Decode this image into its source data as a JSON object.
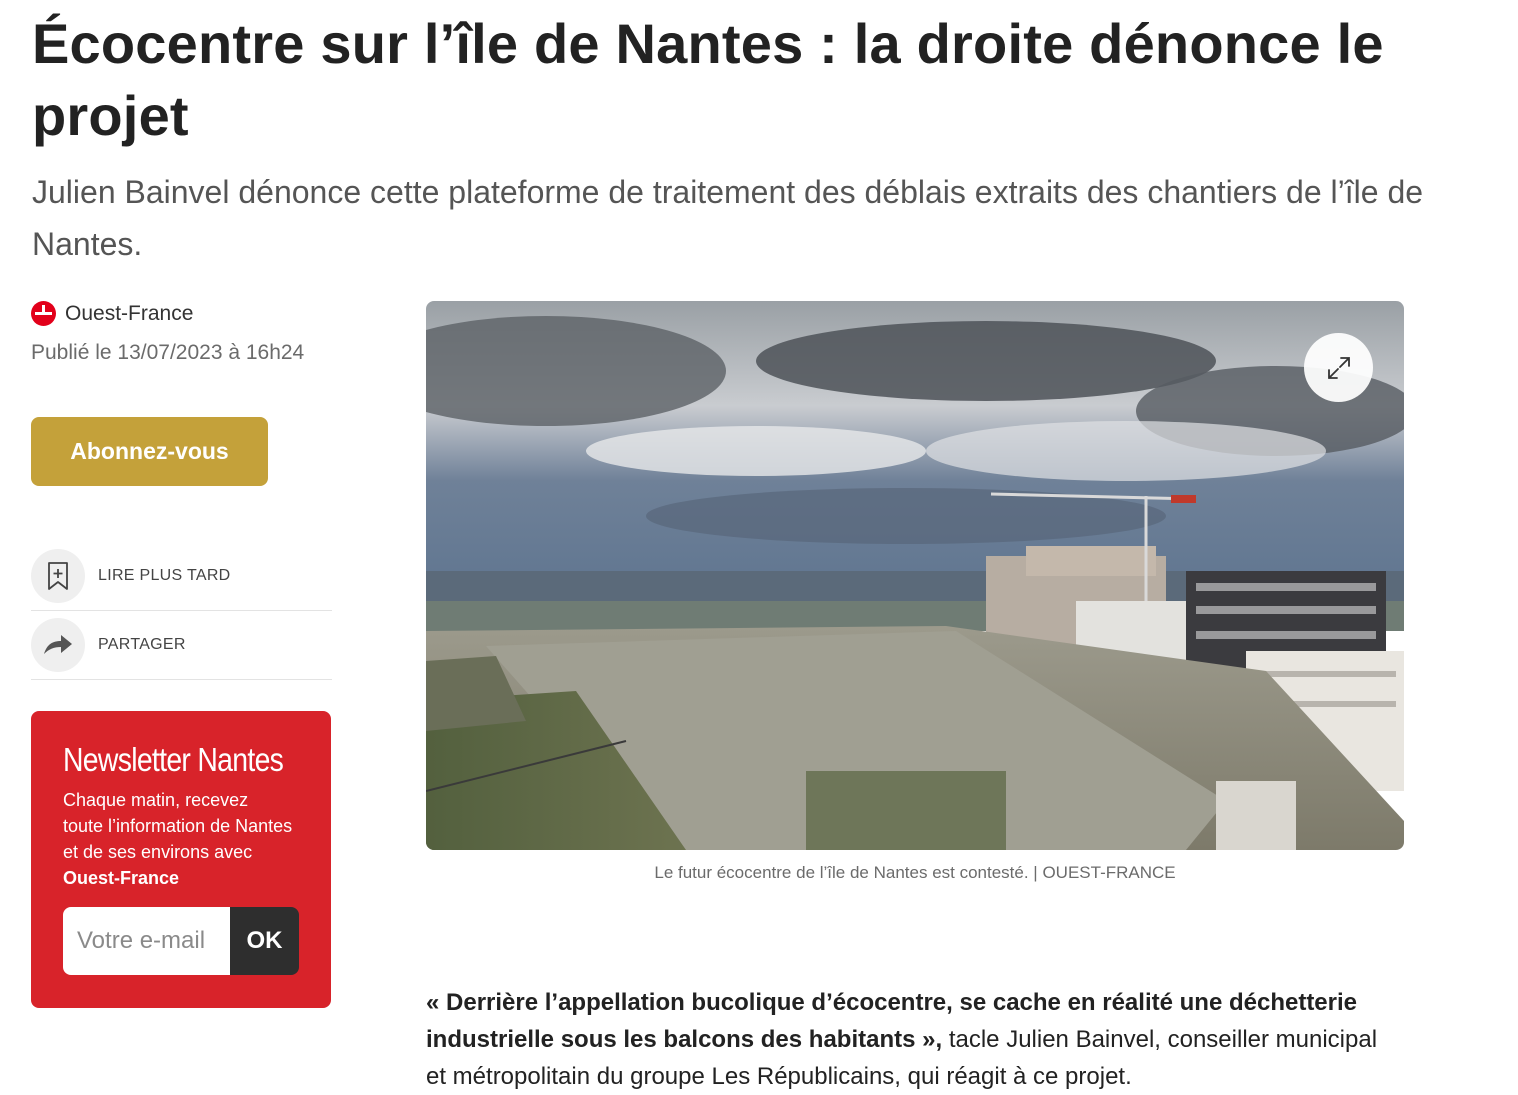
{
  "article": {
    "headline": "Écocentre sur l’île de Nantes : la droite dénonce le projet",
    "subtitle": "Julien Bainvel dénonce cette plateforme de traitement des déblais extraits des chantiers de l’île de Nantes.",
    "source": "Ouest-France",
    "published": "Publié le 13/07/2023 à 16h24",
    "quote": "« Derrière l’appellation bucolique d’écocentre, se cache en réalité une déchetterie industrielle sous les balcons des habitants »,",
    "body_after_quote": " tacle Julien Bainvel, conseiller municipal et métropolitain du groupe Les Républicains, qui réagit à ce projet."
  },
  "subscribe": {
    "label": "Abonnez-vous"
  },
  "actions": {
    "read_later": "LIRE PLUS TARD",
    "share": "PARTAGER"
  },
  "newsletter": {
    "title": "Newsletter Nantes",
    "text": "Chaque matin, recevez toute l’information de Nantes et de ses environs avec ",
    "text_brand": "Ouest-France",
    "placeholder": "Votre e-mail",
    "button": "OK"
  },
  "photo": {
    "caption": "Le futur écocentre de l’île de Nantes est contesté. | OUEST-FRANCE"
  },
  "colors": {
    "brand_red": "#d8232a",
    "logo_red": "#e2001a",
    "subscribe_gold": "#c4a13a",
    "ok_dark": "#2e2e2e"
  }
}
